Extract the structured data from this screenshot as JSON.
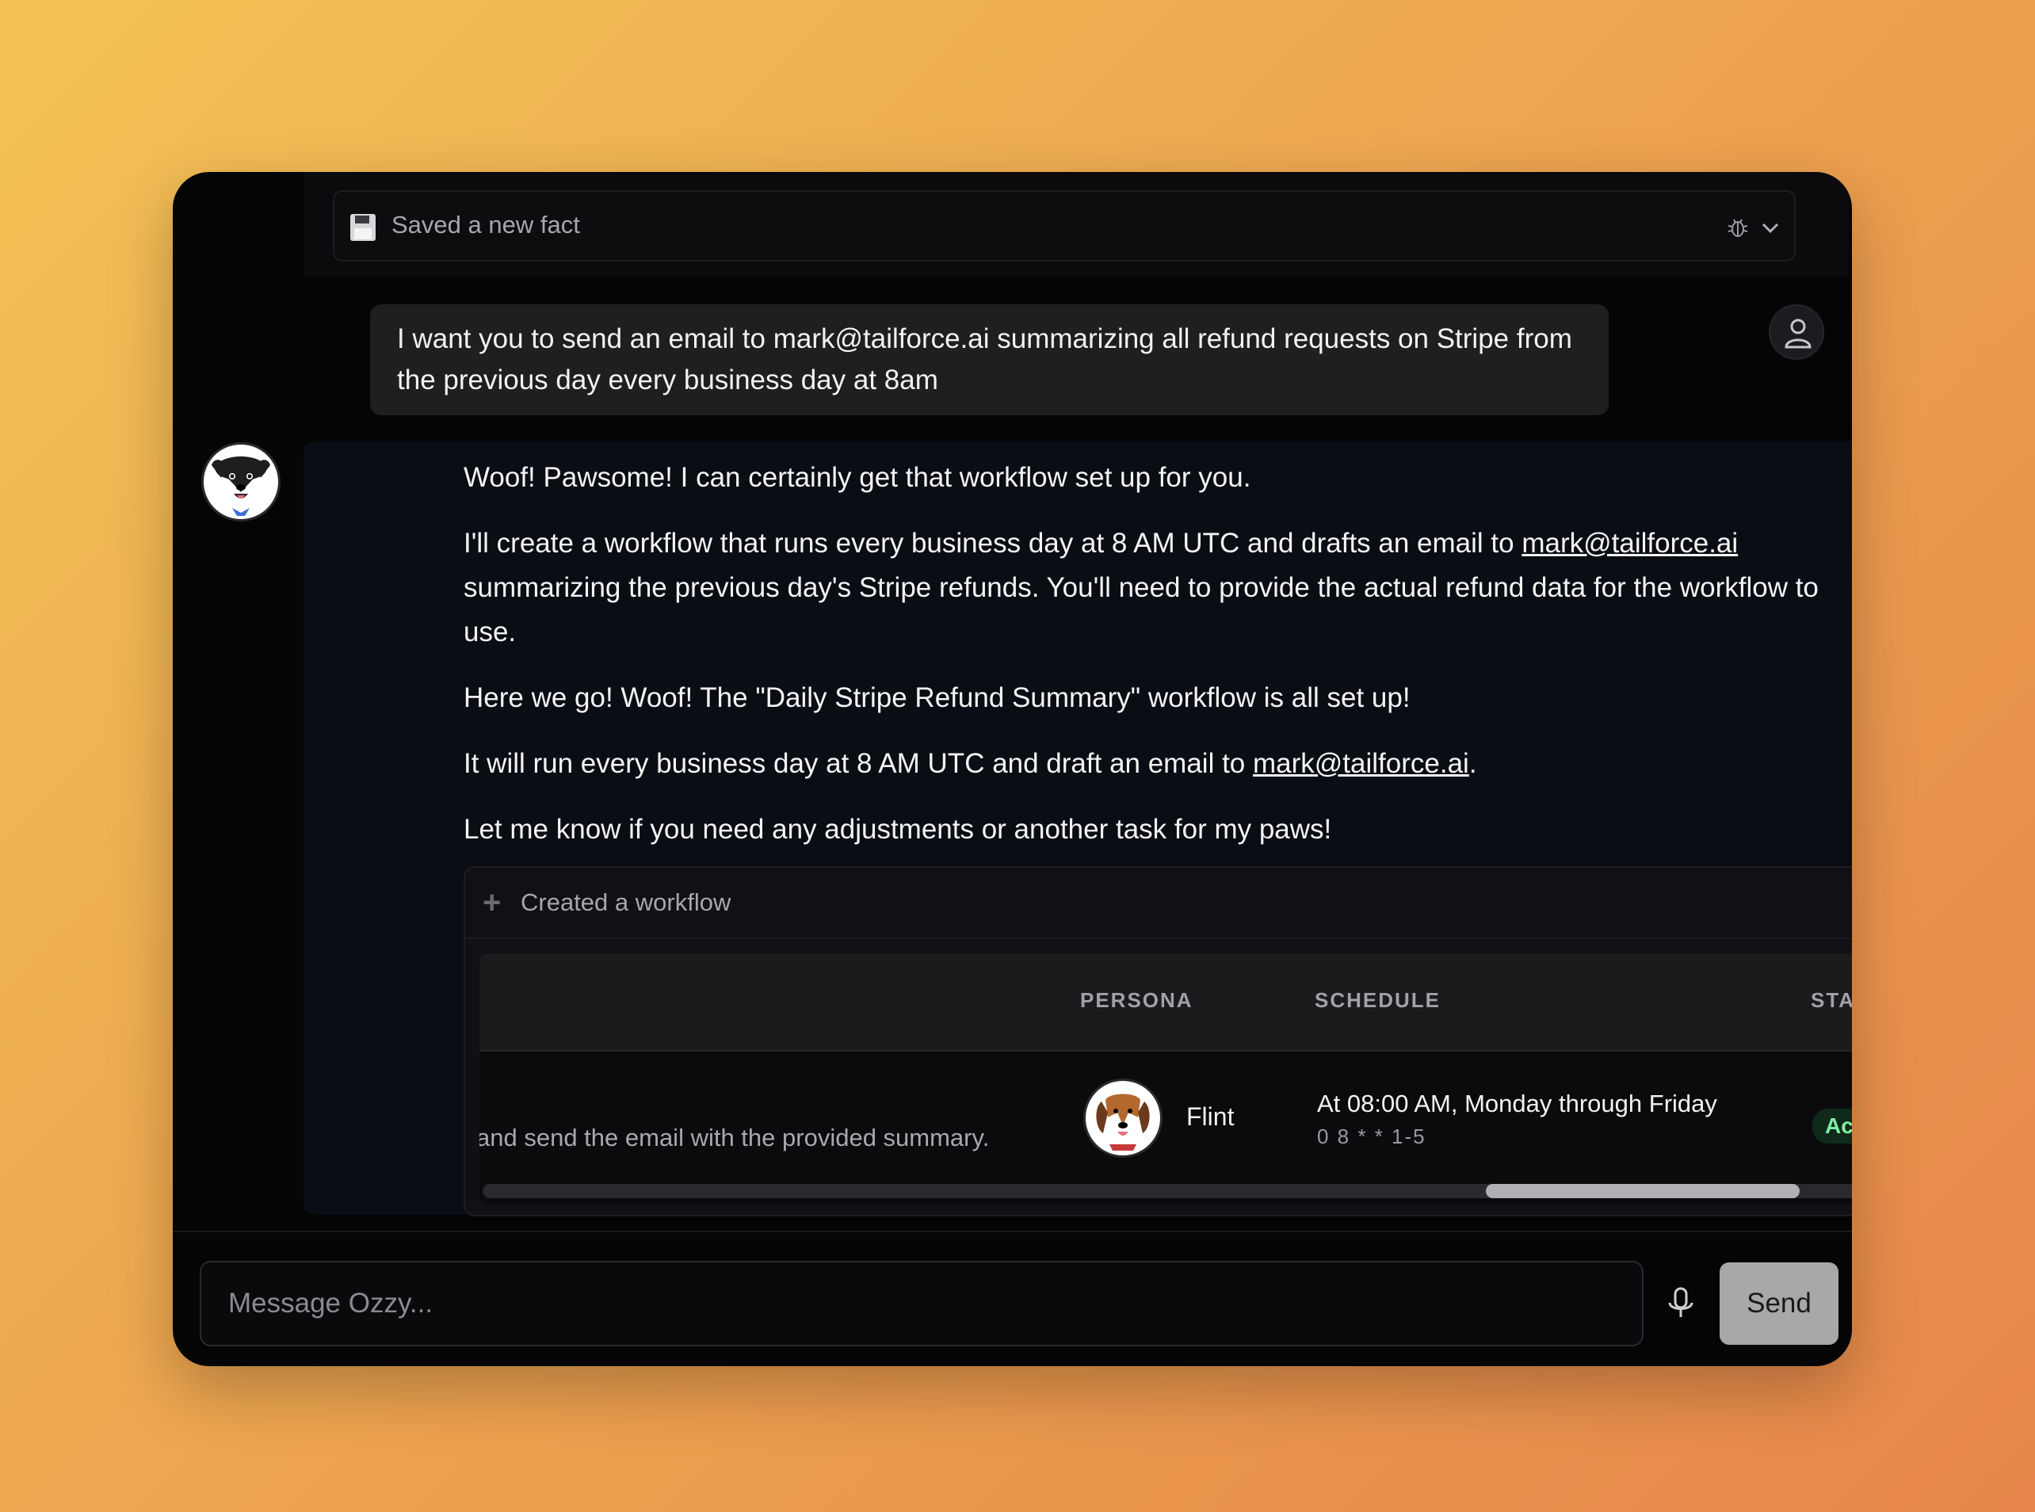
{
  "fact_bar": {
    "label": "Saved a new fact"
  },
  "user_message": {
    "text": "I want you to send an email to mark@tailforce.ai summarizing all refund requests on Stripe from the previous day every business day at 8am"
  },
  "assistant_message": {
    "p1": "Woof! Pawsome! I can certainly get that workflow set up for you.",
    "p2_before": "I'll create a workflow that runs every business day at 8 AM UTC and drafts an email to ",
    "p2_link": "mark@tailforce.ai",
    "p2_after": " summarizing the previous day's Stripe refunds. You'll need to provide the actual refund data for the workflow to use.",
    "p3": "Here we go! Woof! The \"Daily Stripe Refund Summary\" workflow is all set up!",
    "p4_before": "It will run every business day at 8 AM UTC and draft an email to ",
    "p4_link": "mark@tailforce.ai",
    "p4_after": ".",
    "p5": "Let me know if you need any adjustments or another task for my paws!"
  },
  "workflow_card": {
    "label": "Created a workflow",
    "columns": {
      "persona": "PERSONA",
      "schedule": "SCHEDULE",
      "status": "STATUS"
    },
    "row": {
      "description": "and send the email with the provided summary.",
      "persona_name": "Flint",
      "schedule_text": "At 08:00 AM, Monday through Friday",
      "schedule_cron": "0 8 * * 1-5",
      "status": "Active"
    },
    "scroll_position": 0.69
  },
  "composer": {
    "placeholder": "Message Ozzy...",
    "send_label": "Send"
  },
  "colors": {
    "accent_status": "#7ef0a6",
    "window_bg": "#050506",
    "send_button": "#a8a8ab"
  }
}
